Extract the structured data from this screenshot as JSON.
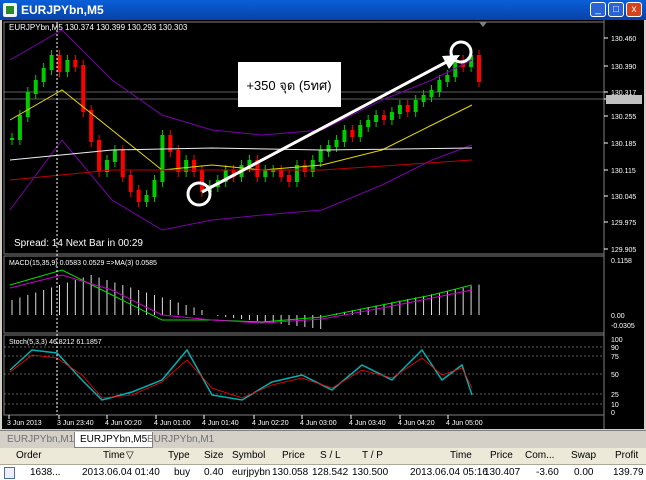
{
  "window": {
    "title": "EURJPYbn,M5",
    "minimize": "_",
    "maximize": "□",
    "close": "x"
  },
  "chart": {
    "symbol_header": "EURJPYbn,M5  130.374 130.399 130.293 130.303",
    "price_ticks": [
      "130.460",
      "130.390",
      "130.317",
      "130.303",
      "130.255",
      "130.185",
      "130.115",
      "130.045",
      "129.975",
      "129.905"
    ],
    "annotation": "+350 จุด (5ทศ)",
    "spread_text": "Spread: 14  Next Bar in 00:29",
    "time_ticks": [
      "3 Jun 2013",
      "3 Jun 23:40",
      "4 Jun 00:20",
      "4 Jun 01:00",
      "4 Jun 01:40",
      "4 Jun 02:20",
      "4 Jun 03:00",
      "4 Jun 03:40",
      "4 Jun 04:20",
      "4 Jun 05:00"
    ]
  },
  "macd": {
    "label": "MACD(15,35,9) 0.0583 0.0529 =>MA(3) 0.0585",
    "ticks": [
      "0.1158",
      "0.00",
      "-0.0305"
    ]
  },
  "stoch": {
    "label": "Stoch(5,3,3) 46.8212 61.1857",
    "ticks": [
      "100",
      "90",
      "75",
      "50",
      "25",
      "10",
      "0"
    ]
  },
  "colors": {
    "bull": "#00cc00",
    "bear": "#ff0000",
    "bollinger": "#7a00aa",
    "ma_yellow": "#e8d800",
    "ma_white": "#f0f0f0",
    "ma_red": "#c00000",
    "macd_line": "#00e000",
    "macd_signal": "#cc00cc",
    "stoch": "#00b0b0"
  },
  "tabs": [
    {
      "label": "EURJPYbn,M15",
      "active": false
    },
    {
      "label": "EURJPYbn,M5",
      "active": true
    },
    {
      "label": "EURJPYbn,M1",
      "active": false
    }
  ],
  "terminal": {
    "headers": {
      "order": "Order",
      "time": "Time",
      "sort_indicator": "▽",
      "type": "Type",
      "size": "Size",
      "symbol": "Symbol",
      "price": "Price",
      "sl": "S / L",
      "tp": "T / P",
      "time2": "Time",
      "price2": "Price",
      "commission": "Com...",
      "swap": "Swap",
      "profit": "Profit"
    },
    "row": {
      "order": "1638...",
      "time": "2013.06.04 01:40",
      "type": "buy",
      "size": "0.40",
      "symbol": "eurjpybn",
      "price": "130.058",
      "sl": "128.542",
      "tp": "130.500",
      "time2": "2013.06.04 05:16",
      "price2": "130.407",
      "commission": "-3.60",
      "swap": "0.00",
      "profit": "139.79"
    }
  }
}
